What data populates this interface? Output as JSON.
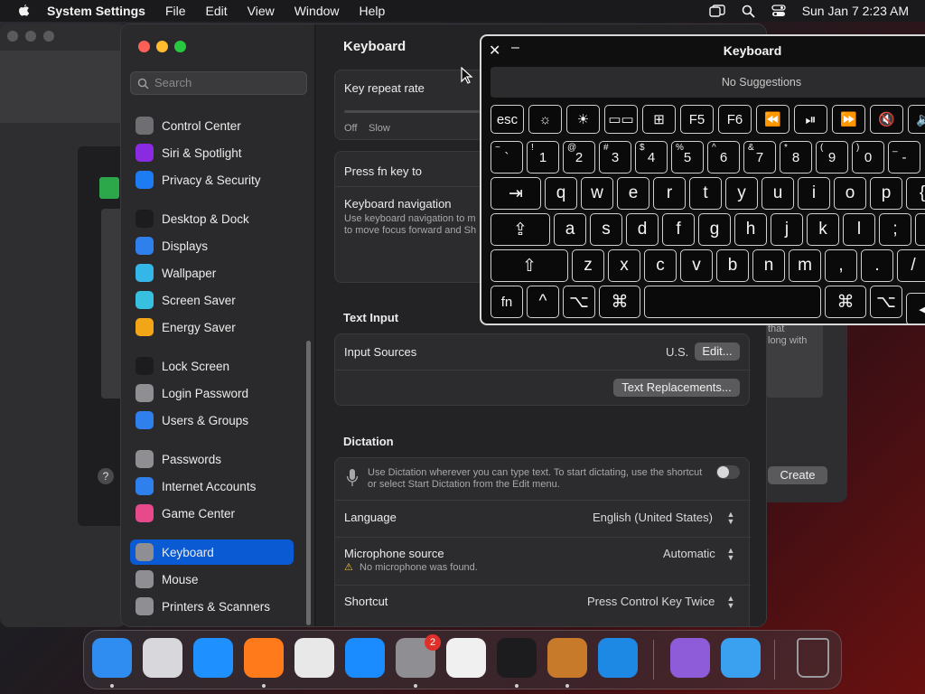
{
  "menubar": {
    "app": "System Settings",
    "menus": [
      "File",
      "Edit",
      "View",
      "Window",
      "Help"
    ],
    "clock": "Sun Jan 7  2:23 AM"
  },
  "sidebar": {
    "search_placeholder": "Search",
    "items": [
      {
        "label": "Control Center",
        "icon": "control-center-icon",
        "color": "#6e6e73"
      },
      {
        "label": "Siri & Spotlight",
        "icon": "siri-icon",
        "color": "#8a2be2"
      },
      {
        "label": "Privacy & Security",
        "icon": "hand-icon",
        "color": "#1e7cf2"
      },
      {
        "label": "Desktop & Dock",
        "icon": "desktop-icon",
        "color": "#1c1c1e"
      },
      {
        "label": "Displays",
        "icon": "displays-icon",
        "color": "#2f80ed"
      },
      {
        "label": "Wallpaper",
        "icon": "wallpaper-icon",
        "color": "#35b6e8"
      },
      {
        "label": "Screen Saver",
        "icon": "screensaver-icon",
        "color": "#38c0e0"
      },
      {
        "label": "Energy Saver",
        "icon": "energy-icon",
        "color": "#f2a516"
      },
      {
        "label": "Lock Screen",
        "icon": "lock-icon",
        "color": "#1c1c1e"
      },
      {
        "label": "Login Password",
        "icon": "login-lock-icon",
        "color": "#8e8e93"
      },
      {
        "label": "Users & Groups",
        "icon": "users-icon",
        "color": "#2f80ed"
      },
      {
        "label": "Passwords",
        "icon": "key-icon",
        "color": "#8e8e93"
      },
      {
        "label": "Internet Accounts",
        "icon": "at-icon",
        "color": "#2f80ed"
      },
      {
        "label": "Game Center",
        "icon": "game-center-icon",
        "color": "#e64a8a"
      },
      {
        "label": "Keyboard",
        "icon": "keyboard-icon",
        "color": "#8e8e93"
      },
      {
        "label": "Mouse",
        "icon": "mouse-icon",
        "color": "#8e8e93"
      },
      {
        "label": "Printers & Scanners",
        "icon": "printer-icon",
        "color": "#8e8e93"
      }
    ]
  },
  "main": {
    "title": "Keyboard",
    "key_repeat": {
      "label": "Key repeat rate",
      "off": "Off",
      "slow": "Slow"
    },
    "press_fn": {
      "label": "Press fn key to"
    },
    "keyboard_nav": {
      "label": "Keyboard navigation",
      "desc_line1": "Use keyboard navigation to m",
      "desc_line2": "to move focus forward and Sh"
    },
    "text_input": {
      "section": "Text Input",
      "input_sources": "Input Sources",
      "input_value": "U.S.",
      "edit_button": "Edit...",
      "replacements_button": "Text Replacements..."
    },
    "dictation": {
      "section": "Dictation",
      "desc_line1": "Use Dictation wherever you can type text. To start dictating, use the shortcut",
      "desc_line2": "or select Start Dictation from the Edit menu.",
      "language_label": "Language",
      "language_value": "English (United States)",
      "mic_label": "Microphone source",
      "mic_value": "Automatic",
      "mic_warning": "No microphone was found.",
      "shortcut_label": "Shortcut",
      "shortcut_value": "Press Control Key Twice"
    }
  },
  "background_window": {
    "text1": "that",
    "text2": "long with",
    "create_button": "Create"
  },
  "keyboard_viewer": {
    "title": "Keyboard",
    "suggestions": "No Suggestions",
    "fn_row": [
      "esc",
      "☼",
      "☀",
      "▭▭",
      "⊞",
      "F5",
      "F6",
      "⏪",
      "⏯",
      "⏩",
      "🔇",
      "🔈"
    ],
    "num_row": [
      {
        "s": "~",
        "m": "`"
      },
      {
        "s": "!",
        "m": "1"
      },
      {
        "s": "@",
        "m": "2"
      },
      {
        "s": "#",
        "m": "3"
      },
      {
        "s": "$",
        "m": "4"
      },
      {
        "s": "%",
        "m": "5"
      },
      {
        "s": "^",
        "m": "6"
      },
      {
        "s": "&",
        "m": "7"
      },
      {
        "s": "*",
        "m": "8"
      },
      {
        "s": "(",
        "m": "9"
      },
      {
        "s": ")",
        "m": "0"
      },
      {
        "s": "_",
        "m": "-"
      }
    ],
    "q_row": [
      "⇥",
      "q",
      "w",
      "e",
      "r",
      "t",
      "y",
      "u",
      "i",
      "o",
      "p",
      "{"
    ],
    "a_row": [
      "⇪",
      "a",
      "s",
      "d",
      "f",
      "g",
      "h",
      "j",
      "k",
      "l",
      ";",
      "\""
    ],
    "z_row": [
      "⇧",
      "z",
      "x",
      "c",
      "v",
      "b",
      "n",
      "m",
      ",",
      ".",
      "/"
    ],
    "mod_row": [
      "fn",
      "^",
      "⌥",
      "⌘",
      "",
      "⌘",
      "⌥",
      "◂"
    ]
  },
  "dock": {
    "apps": [
      {
        "name": "finder",
        "color": "#2f8cf0"
      },
      {
        "name": "launchpad",
        "color": "#d8d8dc"
      },
      {
        "name": "safari",
        "color": "#1e90ff"
      },
      {
        "name": "firefox",
        "color": "#ff7a1a"
      },
      {
        "name": "chrome",
        "color": "#e8e8e8"
      },
      {
        "name": "app-store",
        "color": "#1a8cff"
      },
      {
        "name": "system-settings",
        "color": "#8e8e93"
      },
      {
        "name": "textedit",
        "color": "#f0f0f0"
      },
      {
        "name": "terminal",
        "color": "#1c1c1e"
      },
      {
        "name": "garageband",
        "color": "#c77a2a"
      },
      {
        "name": "vscode",
        "color": "#1e88e5"
      },
      {
        "name": "visual-studio",
        "color": "#8e5cd8"
      },
      {
        "name": "weather",
        "color": "#3aa0f0"
      },
      {
        "name": "trash",
        "color": "#9a9a9e"
      }
    ],
    "badge": "2"
  }
}
